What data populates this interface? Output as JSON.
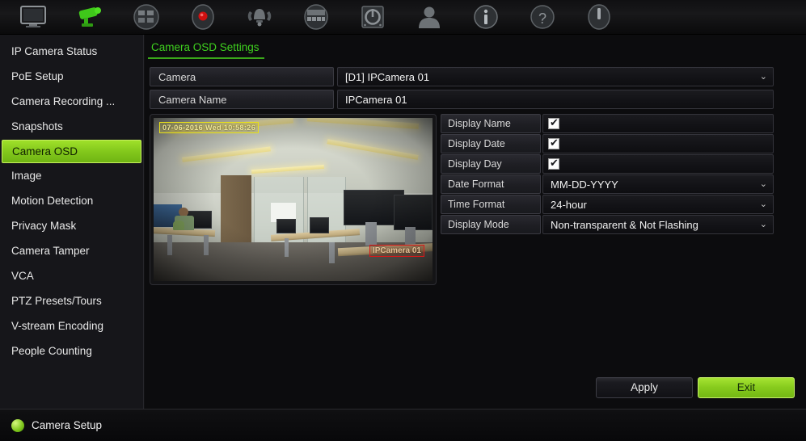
{
  "toolbar": {
    "items": [
      {
        "icon": "monitor-icon",
        "name": "live-view",
        "active": false
      },
      {
        "icon": "camera-icon",
        "name": "camera-setup",
        "active": true
      },
      {
        "icon": "playback-grid-icon",
        "name": "playback",
        "active": false
      },
      {
        "icon": "record-icon",
        "name": "recording",
        "active": false
      },
      {
        "icon": "alarm-bell-icon",
        "name": "alarm",
        "active": false
      },
      {
        "icon": "network-icon",
        "name": "network",
        "active": false
      },
      {
        "icon": "hard-disk-icon",
        "name": "storage",
        "active": false
      },
      {
        "icon": "user-icon",
        "name": "user-management",
        "active": false
      },
      {
        "icon": "info-icon",
        "name": "system-info",
        "active": false
      },
      {
        "icon": "help-icon",
        "name": "help",
        "active": false
      },
      {
        "icon": "power-icon",
        "name": "shutdown",
        "active": false
      }
    ]
  },
  "sidebar": {
    "items": [
      {
        "label": "IP Camera Status",
        "active": false
      },
      {
        "label": "PoE Setup",
        "active": false
      },
      {
        "label": "Camera Recording ...",
        "active": false
      },
      {
        "label": "Snapshots",
        "active": false
      },
      {
        "label": "Camera OSD",
        "active": true
      },
      {
        "label": "Image",
        "active": false
      },
      {
        "label": "Motion Detection",
        "active": false
      },
      {
        "label": "Privacy Mask",
        "active": false
      },
      {
        "label": "Camera Tamper",
        "active": false
      },
      {
        "label": "VCA",
        "active": false
      },
      {
        "label": "PTZ Presets/Tours",
        "active": false
      },
      {
        "label": "V-stream Encoding",
        "active": false
      },
      {
        "label": "People Counting",
        "active": false
      }
    ]
  },
  "main": {
    "tab_label": "Camera OSD Settings",
    "camera_row": {
      "label": "Camera",
      "value": "[D1] IPCamera 01",
      "chevron": "chevron-down-icon"
    },
    "camera_name_row": {
      "label": "Camera Name",
      "value": "IPCamera 01",
      "placeholder": "Camera Name"
    },
    "preview": {
      "osd_datetime": "07-06-2016 Wed 10:58:26",
      "osd_camera_name": "IPCamera 01"
    },
    "osd_settings": [
      {
        "label": "Display Name",
        "type": "checkbox",
        "checked": true
      },
      {
        "label": "Display Date",
        "type": "checkbox",
        "checked": true
      },
      {
        "label": "Display Day",
        "type": "checkbox",
        "checked": true
      },
      {
        "label": "Date Format",
        "type": "select",
        "value": "MM-DD-YYYY",
        "chevron": "chevron-down-icon"
      },
      {
        "label": "Time Format",
        "type": "select",
        "value": "24-hour",
        "chevron": "chevron-down-icon"
      },
      {
        "label": "Display Mode",
        "type": "select",
        "value": "Non-transparent & Not Flashing",
        "chevron": "chevron-down-icon"
      }
    ],
    "buttons": {
      "apply_label": "Apply",
      "exit_label": "Exit"
    }
  },
  "statusbar": {
    "icon": "status-indicator-icon",
    "text": "Camera Setup"
  },
  "colors": {
    "accent_green": "#87cb1d",
    "tab_green": "#3fd21f",
    "panel_bg": "#0c0c0e",
    "sidebar_bg": "#16161a",
    "osd_yellow": "#e8e018",
    "osd_red": "#d81818"
  }
}
